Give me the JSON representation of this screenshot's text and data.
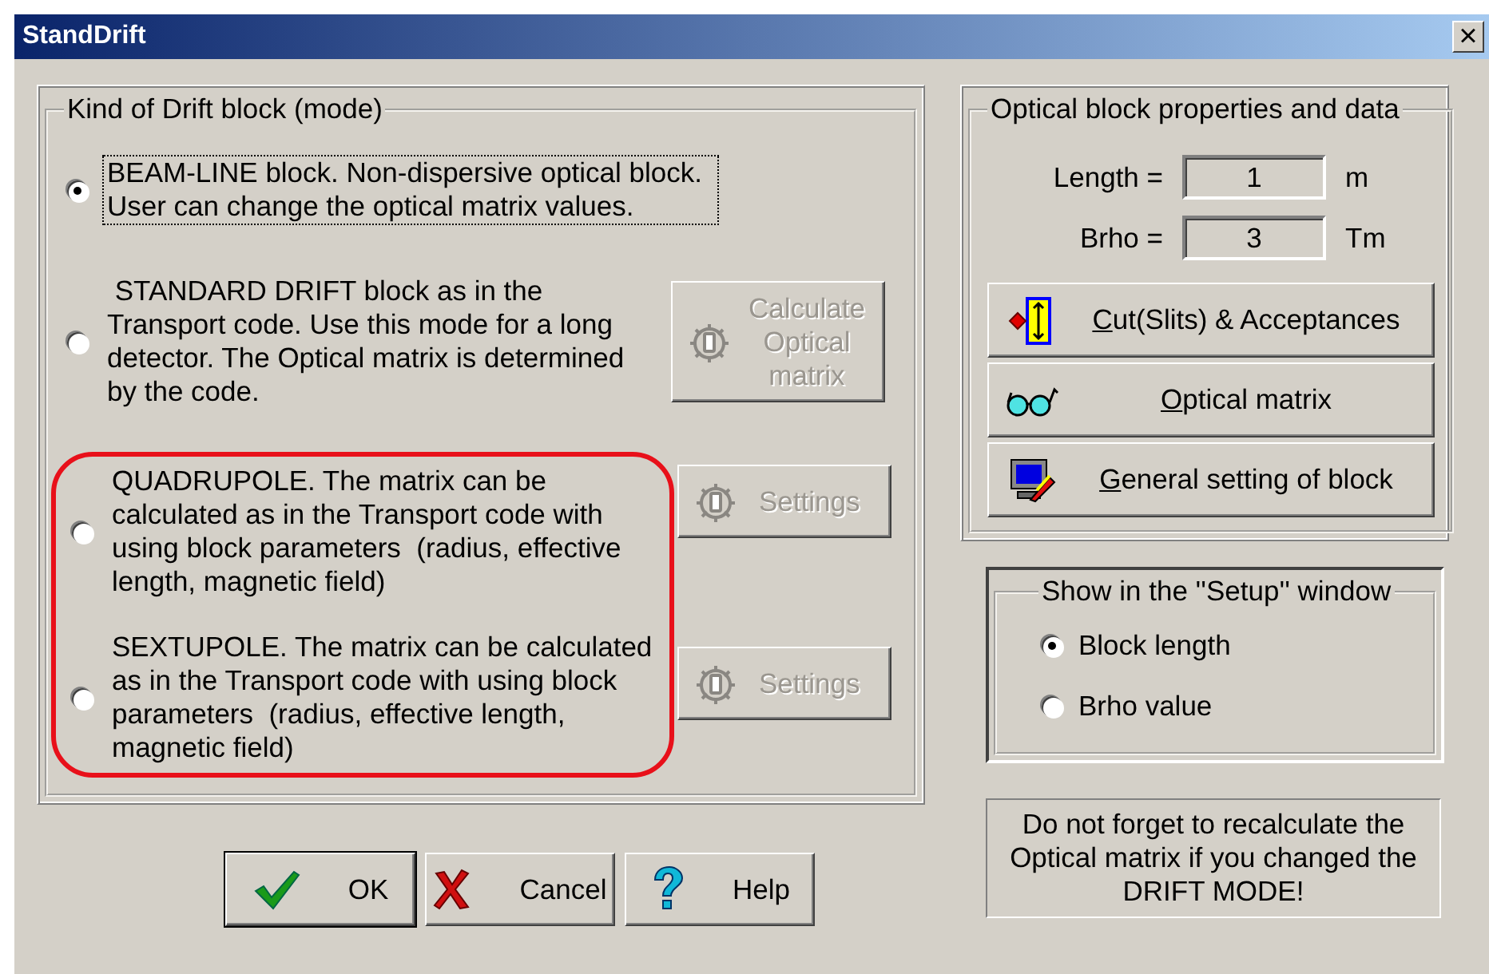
{
  "window": {
    "title": "StandDrift",
    "close": "×"
  },
  "mode_group": {
    "title": "Kind of Drift block (mode)",
    "options": [
      {
        "text": "BEAM-LINE block. Non-dispersive optical block. User can change the optical matrix values.",
        "selected": true,
        "focused": true,
        "highlighted": false
      },
      {
        "text": " STANDARD DRIFT block as in the Transport code. Use this mode for a long detector. The Optical matrix is determined by the code.",
        "selected": false,
        "focused": false,
        "highlighted": false,
        "button": {
          "label": "Calculate Optical matrix",
          "disabled": true
        }
      },
      {
        "text": "QUADRUPOLE. The matrix can be calculated as in the Transport code with using block parameters  (radius, effective length, magnetic field)",
        "selected": false,
        "focused": false,
        "highlighted": true,
        "button": {
          "label": "Settings",
          "disabled": true
        }
      },
      {
        "text": "SEXTUPOLE. The matrix can be calculated as in the Transport code with using block parameters  (radius, effective length, magnetic field)",
        "selected": false,
        "focused": false,
        "highlighted": true,
        "button": {
          "label": "Settings",
          "disabled": true
        }
      }
    ]
  },
  "properties_group": {
    "title": "Optical block properties and data",
    "fields": [
      {
        "label": "Length =",
        "value": "1",
        "unit": "m"
      },
      {
        "label": "Brho =",
        "value": "3",
        "unit": "Tm"
      }
    ],
    "buttons": [
      {
        "kind": "slits",
        "label": "Cut(Slits) & Acceptances",
        "first_letter_underlined": true
      },
      {
        "kind": "glasses",
        "label": "Optical matrix",
        "first_letter_underlined": true
      },
      {
        "kind": "monitor",
        "label": "General setting of block",
        "first_letter_underlined": true
      }
    ]
  },
  "setup_group": {
    "title": "Show in the ''Setup'' window",
    "options": [
      {
        "label": "Block length",
        "selected": true
      },
      {
        "label": "Brho value",
        "selected": false
      }
    ]
  },
  "note": "Do not forget to recalculate the Optical matrix if you changed the DRIFT MODE!",
  "dialog_buttons": [
    {
      "kind": "ok",
      "label": "OK",
      "default": true
    },
    {
      "kind": "cancel",
      "label": "Cancel",
      "default": false
    },
    {
      "kind": "help",
      "label": "Help",
      "default": false
    }
  ]
}
